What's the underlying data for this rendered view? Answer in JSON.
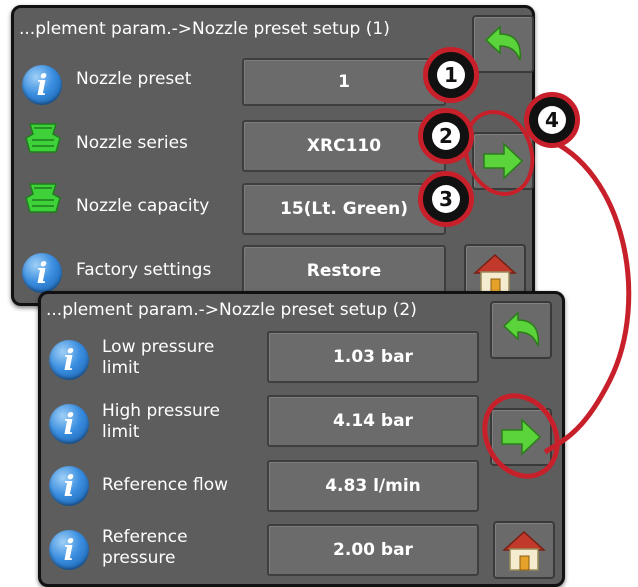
{
  "screen1": {
    "title": "...plement param.->Nozzle preset setup (1)",
    "rows": [
      {
        "label": "Nozzle preset",
        "value": "1",
        "icon": "info-icon"
      },
      {
        "label": "Nozzle series",
        "value": "XRC110",
        "icon": "nozzle-icon"
      },
      {
        "label": "Nozzle capacity",
        "value": "15(Lt. Green)",
        "icon": "nozzle-icon"
      },
      {
        "label": "Factory settings",
        "value": "Restore",
        "icon": "info-icon"
      }
    ]
  },
  "screen2": {
    "title": "...plement param.->Nozzle preset setup (2)",
    "rows": [
      {
        "label": "Low pressure limit",
        "value": "1.03 bar",
        "icon": "info-icon"
      },
      {
        "label": "High pressure limit",
        "value": "4.14 bar",
        "icon": "info-icon"
      },
      {
        "label": "Reference flow",
        "value": "4.83 l/min",
        "icon": "info-icon"
      },
      {
        "label": "Reference pressure",
        "value": "2.00 bar",
        "icon": "info-icon"
      }
    ]
  },
  "callouts": [
    "1",
    "2",
    "3",
    "4"
  ],
  "colors": {
    "panel": "#5d5d5d",
    "accent_red": "#c8202a",
    "nozzle_green": "#3fd13a",
    "info_blue": "#2a7fd4"
  }
}
